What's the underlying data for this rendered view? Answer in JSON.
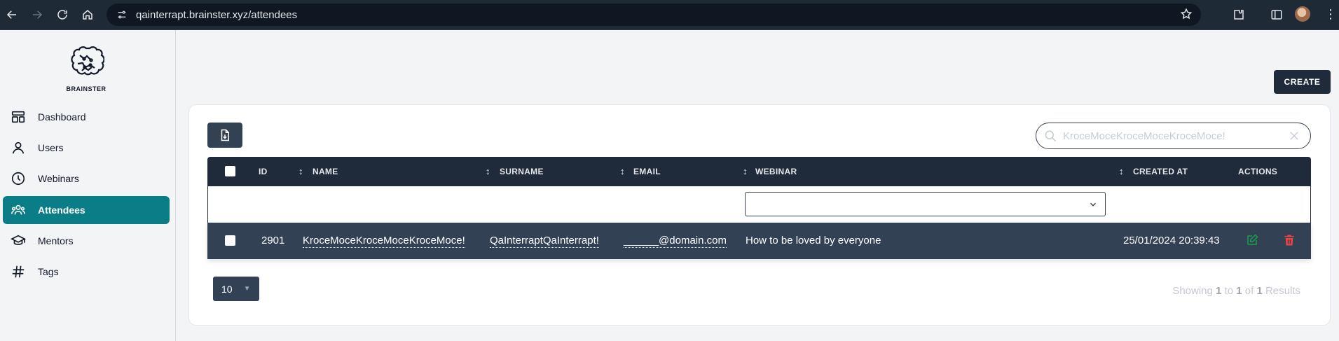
{
  "browser": {
    "url": "qainterrapt.brainster.xyz/attendees"
  },
  "brand": {
    "name": "BRAINSTER"
  },
  "sidebar": {
    "items": [
      {
        "label": "Dashboard",
        "icon": "dashboard-icon"
      },
      {
        "label": "Users",
        "icon": "user-icon"
      },
      {
        "label": "Webinars",
        "icon": "clock-icon"
      },
      {
        "label": "Attendees",
        "icon": "users-group-icon",
        "active": true
      },
      {
        "label": "Mentors",
        "icon": "graduation-cap-icon"
      },
      {
        "label": "Tags",
        "icon": "hash-icon"
      }
    ]
  },
  "toolbar": {
    "create_label": "CREATE"
  },
  "search": {
    "value": "KroceMoceKroceMoceKroceMoce!"
  },
  "table": {
    "columns": {
      "id": "ID",
      "name": "NAME",
      "surname": "SURNAME",
      "email": "EMAIL",
      "webinar": "WEBINAR",
      "created_at": "CREATED AT",
      "actions": "ACTIONS"
    },
    "rows": [
      {
        "id": "2901",
        "name": "KroceMoceKroceMoceKroceMoce!",
        "surname": "QaInterraptQaInterrapt!",
        "email": "______@domain.com",
        "webinar": "How to be loved by everyone",
        "created_at": "25/01/2024 20:39:43"
      }
    ]
  },
  "pagination": {
    "per_page": "10",
    "results_prefix": "Showing",
    "from": "1",
    "to_word": "to",
    "to": "1",
    "of_word": "of",
    "total": "1",
    "results_word": "Results"
  },
  "colors": {
    "accent": "#0b7d86",
    "header_dark": "#1f2a3a",
    "row_dark": "#334155",
    "edit": "#16a34a",
    "delete": "#ef4444"
  }
}
